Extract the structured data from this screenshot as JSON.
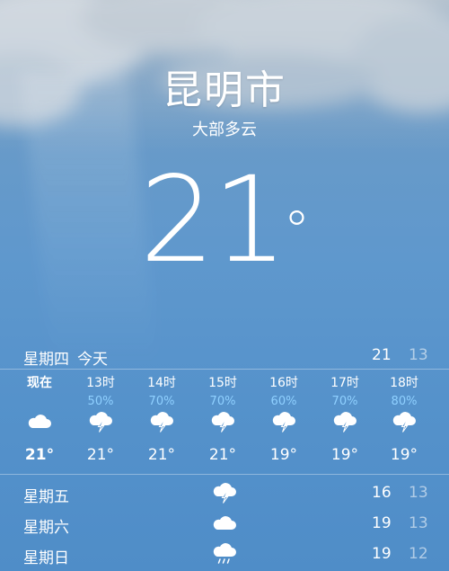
{
  "location": {
    "city": "昆明市",
    "condition": "大部多云"
  },
  "current": {
    "temperature": "21",
    "degree_symbol": "°"
  },
  "today": {
    "weekday": "星期四",
    "label": "今天",
    "high": "21",
    "low": "13"
  },
  "hourly": [
    {
      "time": "现在",
      "precip": "",
      "icon": "cloud-icon",
      "temp": "21°"
    },
    {
      "time": "13时",
      "precip": "50%",
      "icon": "thunderstorm-icon",
      "temp": "21°"
    },
    {
      "time": "14时",
      "precip": "70%",
      "icon": "thunderstorm-icon",
      "temp": "21°"
    },
    {
      "time": "15时",
      "precip": "70%",
      "icon": "thunderstorm-icon",
      "temp": "21°"
    },
    {
      "time": "16时",
      "precip": "60%",
      "icon": "thunderstorm-icon",
      "temp": "19°"
    },
    {
      "time": "17时",
      "precip": "70%",
      "icon": "thunderstorm-icon",
      "temp": "19°"
    },
    {
      "time": "18时",
      "precip": "80%",
      "icon": "thunderstorm-icon",
      "temp": "19°"
    }
  ],
  "daily": [
    {
      "weekday": "星期五",
      "icon": "thunderstorm-icon",
      "high": "16",
      "low": "13"
    },
    {
      "weekday": "星期六",
      "icon": "cloud-icon",
      "high": "19",
      "low": "13"
    },
    {
      "weekday": "星期日",
      "icon": "rain-icon",
      "high": "19",
      "low": "12"
    }
  ],
  "colors": {
    "precip_text": "#8fd0ff",
    "low_temp_text": "rgba(255,255,255,0.55)",
    "sky": "#5592cb"
  }
}
